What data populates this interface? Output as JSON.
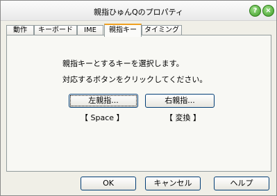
{
  "window": {
    "title": "親指ひゅんQのプロパティ"
  },
  "titlebar": {
    "help_icon": "?",
    "close_icon": "×"
  },
  "tabs": [
    {
      "label": "動作"
    },
    {
      "label": "キーボード"
    },
    {
      "label": "IME"
    },
    {
      "label": "親指キー"
    },
    {
      "label": "タイミング"
    }
  ],
  "active_tab": "親指キー",
  "panel": {
    "line1": "親指キーとするキーを選択します。",
    "line2": "対応するボタンをクリックしてください。",
    "left_button": "左親指...",
    "right_button": "右親指...",
    "left_key": "【 Space 】",
    "right_key": "【 変換 】"
  },
  "footer": {
    "ok": "OK",
    "cancel": "キャンセル",
    "help": "ヘルプ"
  }
}
